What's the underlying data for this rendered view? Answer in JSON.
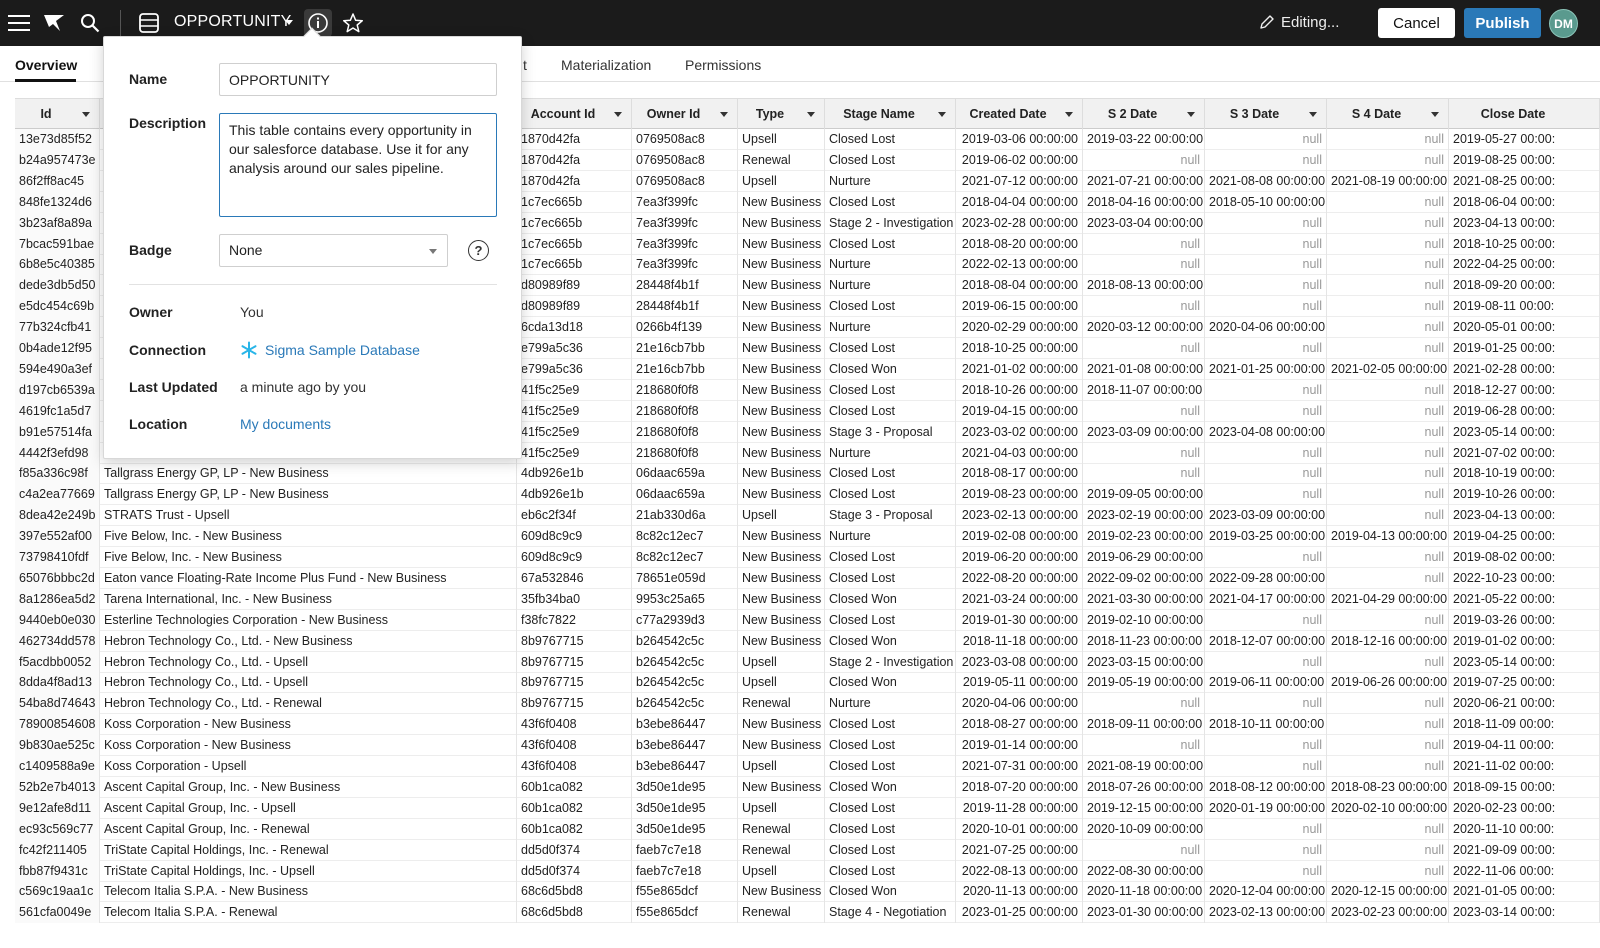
{
  "topbar": {
    "title": "OPPORTUNITY",
    "editing_label": "Editing...",
    "cancel_label": "Cancel",
    "publish_label": "Publish",
    "avatar_initials": "DM",
    "icons": [
      "menu-icon",
      "sigma-logo-icon",
      "search-icon",
      "table-icon",
      "info-icon",
      "star-icon",
      "pencil-icon"
    ]
  },
  "tabs": [
    {
      "label": "Overview",
      "active": true
    },
    {
      "label": "t",
      "active": false
    },
    {
      "label": "Materialization",
      "active": false
    },
    {
      "label": "Permissions",
      "active": false
    }
  ],
  "popover": {
    "name_label": "Name",
    "name_value": "OPPORTUNITY",
    "description_label": "Description",
    "description_value": "This table contains every opportunity in our salesforce database. Use it for any analysis around our sales pipeline.",
    "badge_label": "Badge",
    "badge_value": "None",
    "owner_label": "Owner",
    "owner_value": "You",
    "connection_label": "Connection",
    "connection_value": "Sigma Sample Database",
    "last_updated_label": "Last Updated",
    "last_updated_value": "a minute ago by you",
    "location_label": "Location",
    "location_value": "My documents",
    "help_glyph": "?"
  },
  "table": {
    "columns": [
      "Id",
      "",
      "Account Id",
      "Owner Id",
      "Type",
      "Stage Name",
      "Created Date",
      "S 2 Date",
      "S 3 Date",
      "S 4 Date",
      "Close Date"
    ],
    "rows": [
      [
        "13e73d85f52",
        "",
        "1870d42fa",
        "0769508ac8",
        "Upsell",
        "Closed Lost",
        "2019-03-06 00:00:00",
        "2019-03-22 00:00:00",
        "null",
        "null",
        "2019-05-27 00:00:"
      ],
      [
        "b24a957473e",
        "",
        "1870d42fa",
        "0769508ac8",
        "Renewal",
        "Closed Lost",
        "2019-06-02 00:00:00",
        "null",
        "null",
        "null",
        "2019-08-25 00:00:"
      ],
      [
        "86f2ff8ac45",
        "",
        "1870d42fa",
        "0769508ac8",
        "Upsell",
        "Nurture",
        "2021-07-12 00:00:00",
        "2021-07-21 00:00:00",
        "2021-08-08 00:00:00",
        "2021-08-19 00:00:00",
        "2021-08-25 00:00:"
      ],
      [
        "848fe1324d6",
        "",
        "1c7ec665b",
        "7ea3f399fc",
        "New Business",
        "Closed Lost",
        "2018-04-04 00:00:00",
        "2018-04-16 00:00:00",
        "2018-05-10 00:00:00",
        "null",
        "2018-06-04 00:00:"
      ],
      [
        "3b23af8a89a",
        "",
        "1c7ec665b",
        "7ea3f399fc",
        "New Business",
        "Stage 2 - Investigation",
        "2023-02-28 00:00:00",
        "2023-03-04 00:00:00",
        "null",
        "null",
        "2023-04-13 00:00:"
      ],
      [
        "7bcac591bae",
        "",
        "1c7ec665b",
        "7ea3f399fc",
        "New Business",
        "Closed Lost",
        "2018-08-20 00:00:00",
        "null",
        "null",
        "null",
        "2018-10-25 00:00:"
      ],
      [
        "6b8e5c40385",
        "",
        "1c7ec665b",
        "7ea3f399fc",
        "New Business",
        "Nurture",
        "2022-02-13 00:00:00",
        "null",
        "null",
        "null",
        "2022-04-25 00:00:"
      ],
      [
        "dede3db5d50",
        "",
        "d80989f89",
        "28448f4b1f",
        "New Business",
        "Nurture",
        "2018-08-04 00:00:00",
        "2018-08-13 00:00:00",
        "null",
        "null",
        "2018-09-20 00:00:"
      ],
      [
        "e5dc454c69b",
        "",
        "d80989f89",
        "28448f4b1f",
        "New Business",
        "Closed Lost",
        "2019-06-15 00:00:00",
        "null",
        "null",
        "null",
        "2019-08-11 00:00:"
      ],
      [
        "77b324cfb41",
        "",
        "6cda13d18",
        "0266b4f139",
        "New Business",
        "Nurture",
        "2020-02-29 00:00:00",
        "2020-03-12 00:00:00",
        "2020-04-06 00:00:00",
        "null",
        "2020-05-01 00:00:"
      ],
      [
        "0b4ade12f95",
        "",
        "e799a5c36",
        "21e16cb7bb",
        "New Business",
        "Closed Lost",
        "2018-10-25 00:00:00",
        "null",
        "null",
        "null",
        "2019-01-25 00:00:"
      ],
      [
        "594e490a3ef",
        "",
        "e799a5c36",
        "21e16cb7bb",
        "New Business",
        "Closed Won",
        "2021-01-02 00:00:00",
        "2021-01-08 00:00:00",
        "2021-01-25 00:00:00",
        "2021-02-05 00:00:00",
        "2021-02-28 00:00:"
      ],
      [
        "d197cb6539a",
        "",
        "41f5c25e9",
        "218680f0f8",
        "New Business",
        "Closed Lost",
        "2018-10-26 00:00:00",
        "2018-11-07 00:00:00",
        "null",
        "null",
        "2018-12-27 00:00:"
      ],
      [
        "4619fc1a5d7",
        "",
        "41f5c25e9",
        "218680f0f8",
        "New Business",
        "Closed Lost",
        "2019-04-15 00:00:00",
        "null",
        "null",
        "null",
        "2019-06-28 00:00:"
      ],
      [
        "b91e57514fa",
        "",
        "41f5c25e9",
        "218680f0f8",
        "New Business",
        "Stage 3 - Proposal",
        "2023-03-02 00:00:00",
        "2023-03-09 00:00:00",
        "2023-04-08 00:00:00",
        "null",
        "2023-05-14 00:00:"
      ],
      [
        "4442f3efd98",
        "",
        "41f5c25e9",
        "218680f0f8",
        "New Business",
        "Nurture",
        "2021-04-03 00:00:00",
        "null",
        "null",
        "null",
        "2021-07-02 00:00:"
      ],
      [
        "f85a336c98f",
        "Tallgrass Energy GP, LP - New Business",
        "4db926e1b",
        "06daac659a",
        "New Business",
        "Closed Lost",
        "2018-08-17 00:00:00",
        "null",
        "null",
        "null",
        "2018-10-19 00:00:"
      ],
      [
        "c4a2ea77669",
        "Tallgrass Energy GP, LP - New Business",
        "4db926e1b",
        "06daac659a",
        "New Business",
        "Closed Lost",
        "2019-08-23 00:00:00",
        "2019-09-05 00:00:00",
        "null",
        "null",
        "2019-10-26 00:00:"
      ],
      [
        "8dea42e249b",
        "STRATS Trust - Upsell",
        "eb6c2f34f",
        "21ab330d6a",
        "Upsell",
        "Stage 3 - Proposal",
        "2023-02-13 00:00:00",
        "2023-02-19 00:00:00",
        "2023-03-09 00:00:00",
        "null",
        "2023-04-13 00:00:"
      ],
      [
        "397e552af00",
        "Five Below, Inc. - New Business",
        "609d8c9c9",
        "8c82c12ec7",
        "New Business",
        "Nurture",
        "2019-02-08 00:00:00",
        "2019-02-23 00:00:00",
        "2019-03-25 00:00:00",
        "2019-04-13 00:00:00",
        "2019-04-25 00:00:"
      ],
      [
        "73798410fdf",
        "Five Below, Inc. - New Business",
        "609d8c9c9",
        "8c82c12ec7",
        "New Business",
        "Closed Lost",
        "2019-06-20 00:00:00",
        "2019-06-29 00:00:00",
        "null",
        "null",
        "2019-08-02 00:00:"
      ],
      [
        "65076bbbc2d",
        "Eaton vance Floating-Rate Income Plus Fund - New Business",
        "67a532846",
        "78651e059d",
        "New Business",
        "Closed Lost",
        "2022-08-20 00:00:00",
        "2022-09-02 00:00:00",
        "2022-09-28 00:00:00",
        "null",
        "2022-10-23 00:00:"
      ],
      [
        "8a1286ea5d2",
        "Tarena International, Inc. - New Business",
        "35fb34ba0",
        "9953c25a65",
        "New Business",
        "Closed Won",
        "2021-03-24 00:00:00",
        "2021-03-30 00:00:00",
        "2021-04-17 00:00:00",
        "2021-04-29 00:00:00",
        "2021-05-22 00:00:"
      ],
      [
        "9440eb0e030",
        "Esterline Technologies Corporation - New Business",
        "f38fc7822",
        "c77a2939d3",
        "New Business",
        "Closed Lost",
        "2019-01-30 00:00:00",
        "2019-02-10 00:00:00",
        "null",
        "null",
        "2019-03-26 00:00:"
      ],
      [
        "462734dd578",
        "Hebron Technology Co., Ltd. - New Business",
        "8b9767715",
        "b264542c5c",
        "New Business",
        "Closed Won",
        "2018-11-18 00:00:00",
        "2018-11-23 00:00:00",
        "2018-12-07 00:00:00",
        "2018-12-16 00:00:00",
        "2019-01-02 00:00:"
      ],
      [
        "f5acdbb0052",
        "Hebron Technology Co., Ltd. - Upsell",
        "8b9767715",
        "b264542c5c",
        "Upsell",
        "Stage 2 - Investigation",
        "2023-03-08 00:00:00",
        "2023-03-15 00:00:00",
        "null",
        "null",
        "2023-05-14 00:00:"
      ],
      [
        "8dda4f8ad13",
        "Hebron Technology Co., Ltd. - Upsell",
        "8b9767715",
        "b264542c5c",
        "Upsell",
        "Closed Won",
        "2019-05-11 00:00:00",
        "2019-05-19 00:00:00",
        "2019-06-11 00:00:00",
        "2019-06-26 00:00:00",
        "2019-07-25 00:00:"
      ],
      [
        "54ba8d74643",
        "Hebron Technology Co., Ltd. - Renewal",
        "8b9767715",
        "b264542c5c",
        "Renewal",
        "Nurture",
        "2020-04-06 00:00:00",
        "null",
        "null",
        "null",
        "2020-06-21 00:00:"
      ],
      [
        "78900854608",
        "Koss Corporation - New Business",
        "43f6f0408",
        "b3ebe86447",
        "New Business",
        "Closed Lost",
        "2018-08-27 00:00:00",
        "2018-09-11 00:00:00",
        "2018-10-11 00:00:00",
        "null",
        "2018-11-09 00:00:"
      ],
      [
        "9b830ae525c",
        "Koss Corporation - New Business",
        "43f6f0408",
        "b3ebe86447",
        "New Business",
        "Closed Lost",
        "2019-01-14 00:00:00",
        "null",
        "null",
        "null",
        "2019-04-11 00:00:"
      ],
      [
        "c1409588a9e",
        "Koss Corporation - Upsell",
        "43f6f0408",
        "b3ebe86447",
        "Upsell",
        "Closed Lost",
        "2021-07-31 00:00:00",
        "2021-08-19 00:00:00",
        "null",
        "null",
        "2021-11-02 00:00:"
      ],
      [
        "52b2e7b4013",
        "Ascent Capital Group, Inc. - New Business",
        "60b1ca082",
        "3d50e1de95",
        "New Business",
        "Closed Won",
        "2018-07-20 00:00:00",
        "2018-07-26 00:00:00",
        "2018-08-12 00:00:00",
        "2018-08-23 00:00:00",
        "2018-09-15 00:00:"
      ],
      [
        "9e12afe8d11",
        "Ascent Capital Group, Inc. - Upsell",
        "60b1ca082",
        "3d50e1de95",
        "Upsell",
        "Closed Lost",
        "2019-11-28 00:00:00",
        "2019-12-15 00:00:00",
        "2020-01-19 00:00:00",
        "2020-02-10 00:00:00",
        "2020-02-23 00:00:"
      ],
      [
        "ec93c569c77",
        "Ascent Capital Group, Inc. - Renewal",
        "60b1ca082",
        "3d50e1de95",
        "Renewal",
        "Closed Lost",
        "2020-10-01 00:00:00",
        "2020-10-09 00:00:00",
        "null",
        "null",
        "2020-11-10 00:00:"
      ],
      [
        "fc42f211405",
        "TriState Capital Holdings, Inc. - Renewal",
        "dd5d0f374",
        "faeb7c7e18",
        "Renewal",
        "Closed Lost",
        "2021-07-25 00:00:00",
        "null",
        "null",
        "null",
        "2021-09-09 00:00:"
      ],
      [
        "fbb87f9431c",
        "TriState Capital Holdings, Inc. - Upsell",
        "dd5d0f374",
        "faeb7c7e18",
        "Upsell",
        "Closed Lost",
        "2022-08-13 00:00:00",
        "2022-08-30 00:00:00",
        "null",
        "null",
        "2022-11-06 00:00:"
      ],
      [
        "c569c19aa1c",
        "Telecom Italia S.P.A. - New Business",
        "68c6d5bd8",
        "f55e865dcf",
        "New Business",
        "Closed Won",
        "2020-11-13 00:00:00",
        "2020-11-18 00:00:00",
        "2020-12-04 00:00:00",
        "2020-12-15 00:00:00",
        "2021-01-05 00:00:"
      ],
      [
        "561cfa0049e",
        "Telecom Italia S.P.A. - Renewal",
        "68c6d5bd8",
        "f55e865dcf",
        "Renewal",
        "Stage 4 - Negotiation",
        "2023-01-25 00:00:00",
        "2023-01-30 00:00:00",
        "2023-02-13 00:00:00",
        "2023-02-23 00:00:00",
        "2023-03-14 00:00:"
      ]
    ]
  }
}
